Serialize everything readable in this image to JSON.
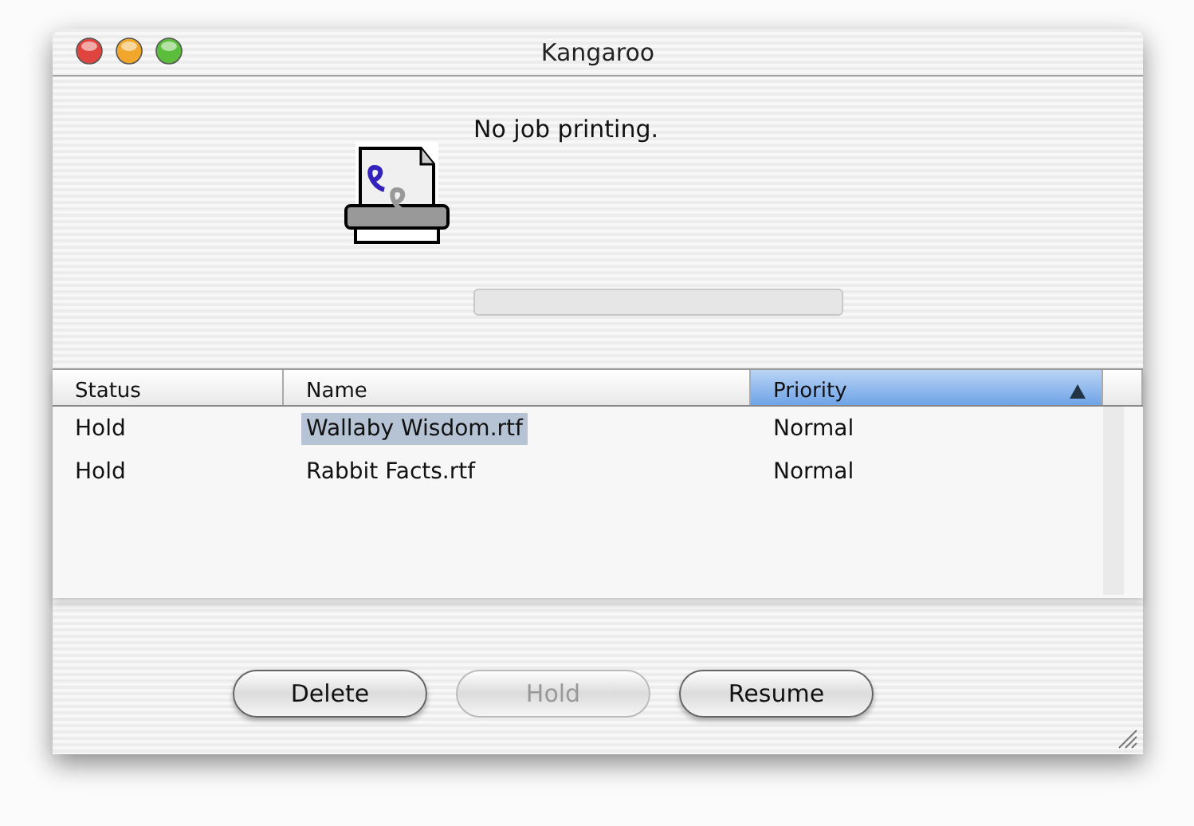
{
  "window": {
    "title": "Kangaroo"
  },
  "status": {
    "message": "No job printing.",
    "progress": {
      "level": 0
    }
  },
  "table": {
    "columns": [
      {
        "label": "Status",
        "selected": false
      },
      {
        "label": "Name",
        "selected": false
      },
      {
        "label": "Priority",
        "selected": true
      }
    ],
    "rows": [
      {
        "status": "Hold",
        "name": "Wallaby Wisdom.rtf",
        "priority": "Normal",
        "selected": true
      },
      {
        "status": "Hold",
        "name": "Rabbit Facts.rtf",
        "priority": "Normal",
        "selected": false
      }
    ]
  },
  "buttons": [
    {
      "label": "Delete",
      "disabled": false
    },
    {
      "label": "Hold",
      "disabled": true
    },
    {
      "label": "Resume",
      "disabled": false
    }
  ]
}
